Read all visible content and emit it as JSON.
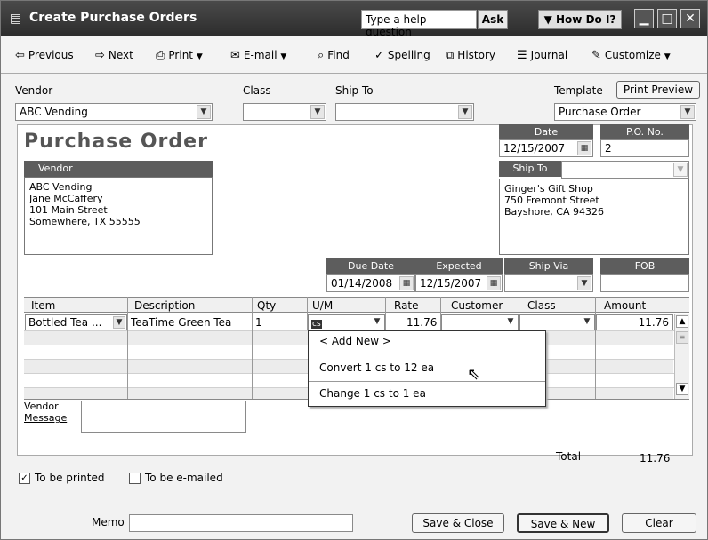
{
  "title": {
    "text": "Create Purchase Orders",
    "help_placeholder": "Type a help question",
    "ask": "Ask",
    "how_do_i": "How Do I?"
  },
  "toolbar": {
    "previous": "Previous",
    "next": "Next",
    "print": "Print",
    "email": "E-mail",
    "find": "Find",
    "spelling": "Spelling",
    "history": "History",
    "journal": "Journal",
    "customize": "Customize"
  },
  "header": {
    "vendor_label": "Vendor",
    "class_label": "Class",
    "ship_to_label": "Ship To",
    "template_label": "Template",
    "print_preview": "Print Preview",
    "vendor_value": "ABC Vending",
    "class_value": "",
    "ship_to_value": "",
    "template_value": "Purchase Order"
  },
  "form": {
    "title": "Purchase Order",
    "date_label": "Date",
    "date_value": "12/15/2007",
    "po_label": "P.O. No.",
    "po_value": "2",
    "vendor_box_label": "Vendor",
    "vendor_address": [
      "ABC Vending",
      "Jane McCaffery",
      "101 Main Street",
      "Somewhere, TX 55555"
    ],
    "ship_to_label": "Ship To",
    "ship_to_address": [
      "Ginger's Gift Shop",
      "750 Fremont Street",
      "Bayshore, CA 94326"
    ],
    "due_date_label": "Due Date",
    "due_date_value": "01/14/2008",
    "expected_label": "Expected",
    "expected_value": "12/15/2007",
    "ship_via_label": "Ship Via",
    "fob_label": "FOB"
  },
  "grid": {
    "columns": [
      "Item",
      "Description",
      "Qty",
      "U/M",
      "Rate",
      "Customer",
      "Class",
      "Amount"
    ],
    "rows": [
      {
        "item": "Bottled Tea ...",
        "description": "TeaTime Green Tea",
        "qty": "1",
        "um": "cs",
        "rate": "11.76",
        "customer": "",
        "class": "",
        "amount": "11.76"
      }
    ]
  },
  "um_popup": {
    "items": [
      "< Add New >",
      "Convert 1 cs to 12 ea",
      "Change 1 cs to 1 ea"
    ]
  },
  "footer": {
    "vendor_message_label_1": "Vendor",
    "vendor_message_label_2": "Message",
    "total_label": "Total",
    "total_value": "11.76",
    "to_be_printed": "To be printed",
    "to_be_emailed": "To be e-mailed",
    "memo_label": "Memo",
    "save_close": "Save & Close",
    "save_new": "Save & New",
    "clear": "Clear"
  }
}
